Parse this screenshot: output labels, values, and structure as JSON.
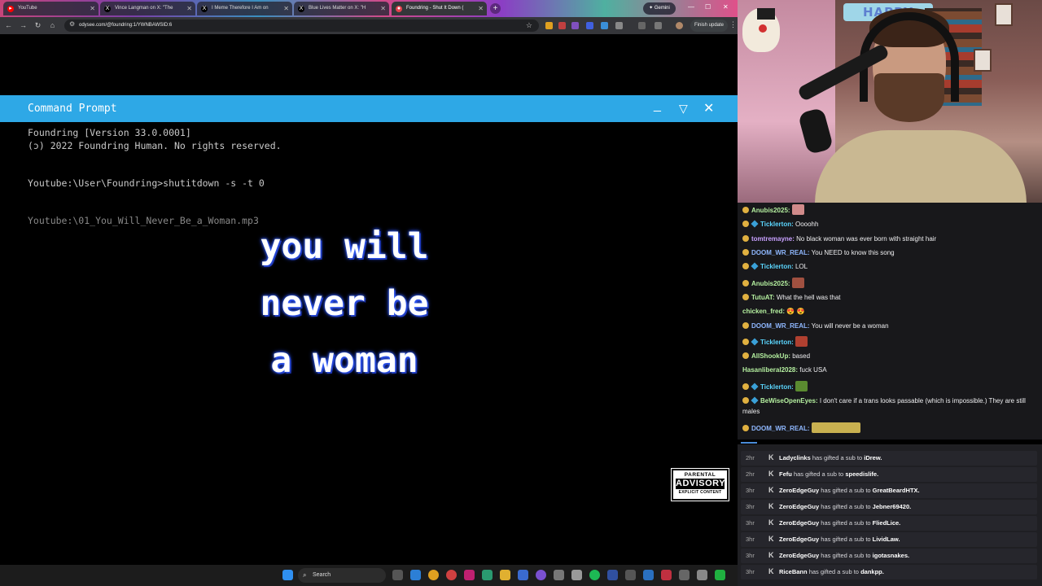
{
  "browser": {
    "tabs": [
      {
        "label": "YouTube",
        "favicon": "youtube-icon",
        "color": "#ff0000"
      },
      {
        "label": "Vince Langman on X: \"The",
        "favicon": "x-icon",
        "color": "#000000"
      },
      {
        "label": "I Meme Therefore I Am on",
        "favicon": "x-icon",
        "color": "#000000"
      },
      {
        "label": "Blue Lives Matter on X: \"H",
        "favicon": "x-icon",
        "color": "#000000"
      },
      {
        "label": "Foundring - Shut It Down (",
        "favicon": "odysee-icon",
        "color": "#e5414d"
      }
    ],
    "gemini_label": "Gemini",
    "url": "odysee.com/@foundring:1/YWNBAWSID:6",
    "finish_update_label": "Finish update"
  },
  "command_prompt": {
    "title": "Command Prompt",
    "line1": "Foundring [Version 33.0.0001]",
    "line2": "(ɔ) 2022 Foundring Human. No rights reserved.",
    "command": "Youtube:\\User\\Foundring>shutitdown -s -t 0",
    "file": "Youtube:\\01_You_Will_Never_Be_a_Woman.mp3",
    "lyric_lines": [
      "you will",
      "never be",
      "a woman"
    ],
    "advisory": {
      "top": "PARENTAL",
      "mid": "ADVISORY",
      "bottom": "EXPLICIT CONTENT"
    }
  },
  "taskbar": {
    "search_placeholder": "Search"
  },
  "webcam": {
    "banner": "HAPPY EAST"
  },
  "chat": {
    "messages": [
      {
        "user": "Anubis2025:",
        "text": "",
        "user_color": "#b5f0a0",
        "sub": false,
        "emote": "#d08a8a"
      },
      {
        "user": "Ticklerton:",
        "text": "Oooohh",
        "user_color": "#5bd6ff",
        "sub": true,
        "emote": ""
      },
      {
        "user": "tomtremayne:",
        "text": "No black woman was ever born with straight hair",
        "user_color": "#c8a0ff",
        "sub": false,
        "emote": ""
      },
      {
        "user": "DOOM_WR_REAL:",
        "text": "You NEED to know this song",
        "user_color": "#8fb8ff",
        "sub": false,
        "emote": ""
      },
      {
        "user": "Ticklerton:",
        "text": "LOL",
        "user_color": "#5bd6ff",
        "sub": true,
        "emote": ""
      },
      {
        "user": "Anubis2025:",
        "text": "",
        "user_color": "#b5f0a0",
        "sub": false,
        "emote": "#a05040"
      },
      {
        "user": "TutuAT:",
        "text": "What the hell was that",
        "user_color": "#b5f0a0",
        "sub": false,
        "emote": ""
      },
      {
        "user": "chicken_fred:",
        "text": "😍 😍",
        "user_color": "#b5f0a0",
        "sub": false,
        "emote": "",
        "nobadge": true
      },
      {
        "user": "DOOM_WR_REAL:",
        "text": "You will never be a woman",
        "user_color": "#8fb8ff",
        "sub": false,
        "emote": ""
      },
      {
        "user": "Ticklerton:",
        "text": "",
        "user_color": "#5bd6ff",
        "sub": true,
        "emote": "#b04030"
      },
      {
        "user": "AllShookUp:",
        "text": "based",
        "user_color": "#b5f0a0",
        "sub": false,
        "emote": ""
      },
      {
        "user": "Hasanliberal2028:",
        "text": "fuck USA",
        "user_color": "#b5f0a0",
        "sub": false,
        "emote": "",
        "nobadge": true
      },
      {
        "user": "Ticklerton:",
        "text": "",
        "user_color": "#5bd6ff",
        "sub": true,
        "emote": "#5a8a30"
      },
      {
        "user": "BeWiseOpenEyes:",
        "text": "I don't care if a trans looks passable (which is impossible.) They are still males",
        "user_color": "#b5f0a0",
        "sub": true,
        "emote": ""
      },
      {
        "user": "DOOM_WR_REAL:",
        "text": "",
        "user_color": "#8fb8ff",
        "sub": false,
        "emote": "#c8b050"
      }
    ]
  },
  "events": [
    {
      "time": "2hr",
      "actor": "Ladyclinks",
      "action": "has gifted a sub to",
      "target": "iDrew."
    },
    {
      "time": "2hr",
      "actor": "Fefu",
      "action": "has gifted a sub to",
      "target": "speedislife."
    },
    {
      "time": "3hr",
      "actor": "ZeroEdgeGuy",
      "action": "has gifted a sub to",
      "target": "GreatBeardHTX."
    },
    {
      "time": "3hr",
      "actor": "ZeroEdgeGuy",
      "action": "has gifted a sub to",
      "target": "Jebner69420."
    },
    {
      "time": "3hr",
      "actor": "ZeroEdgeGuy",
      "action": "has gifted a sub to",
      "target": "FliedLice."
    },
    {
      "time": "3hr",
      "actor": "ZeroEdgeGuy",
      "action": "has gifted a sub to",
      "target": "LividLaw."
    },
    {
      "time": "3hr",
      "actor": "ZeroEdgeGuy",
      "action": "has gifted a sub to",
      "target": "igotasnakes."
    },
    {
      "time": "3hr",
      "actor": "RiceBann",
      "action": "has gifted a sub to",
      "target": "dankpp."
    }
  ]
}
